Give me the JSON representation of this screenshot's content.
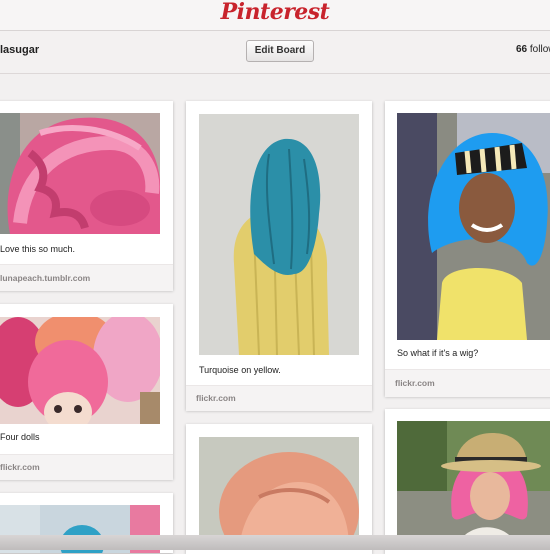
{
  "header": {
    "logo": "Pinterest"
  },
  "board": {
    "owner": "lasugar",
    "edit_label": "Edit Board",
    "followers_count": "66",
    "followers_label": "follow"
  },
  "pins": [
    {
      "caption": "Love this so much.",
      "source": "lunapeach.tumblr.com",
      "photo": "pink-braided-hair-photo"
    },
    {
      "caption": "Four dolls",
      "source": "flickr.com",
      "photo": "pink-haired-dolls-photo"
    },
    {
      "caption": "Turquoise on yellow.",
      "source": "flickr.com",
      "photo": "turquoise-hair-yellow-sweater-photo"
    },
    {
      "caption": "",
      "source": "",
      "photo": "peach-hair-photo"
    },
    {
      "caption": "So what if it's a wig?",
      "source": "flickr.com",
      "photo": "blue-wig-woman-photo"
    },
    {
      "caption": "",
      "source": "",
      "photo": "pink-bob-hat-photo"
    }
  ]
}
